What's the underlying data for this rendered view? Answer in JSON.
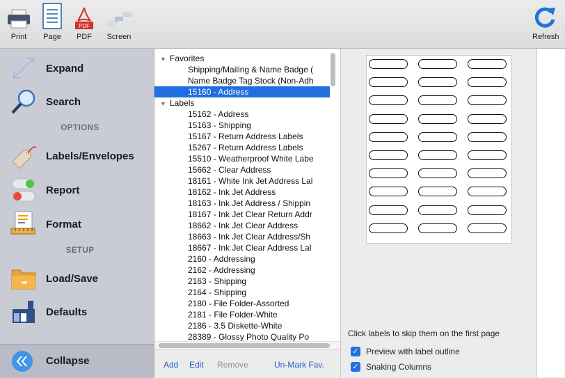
{
  "toolbar": {
    "items": [
      {
        "label": "Print",
        "icon": "printer-icon"
      },
      {
        "label": "Page",
        "icon": "page-icon"
      },
      {
        "label": "PDF",
        "icon": "pdf-icon",
        "badge": "PDF"
      },
      {
        "label": "Screen",
        "icon": "screen-icon"
      }
    ],
    "refresh_label": "Refresh"
  },
  "sidebar": {
    "expand": "Expand",
    "search": "Search",
    "options_header": "OPTIONS",
    "labels_envelopes": "Labels/Envelopes",
    "report": "Report",
    "format": "Format",
    "setup_header": "SETUP",
    "load_save": "Load/Save",
    "defaults": "Defaults",
    "collapse": "Collapse"
  },
  "list": {
    "favorites_header": "Favorites",
    "favorites": [
      "Shipping/Mailing & Name Badge (",
      "Name Badge Tag Stock (Non-Adh",
      "15160 - Address"
    ],
    "selected": "15160 - Address",
    "labels_header": "Labels",
    "labels": [
      "15162 - Address",
      "15163 - Shipping",
      "15167 - Return Address Labels",
      "15267 - Return Address Labels",
      "15510 - Weatherproof White Labe",
      "15662 - Clear Address",
      "18161 - White Ink Jet Address Lal",
      "18162 - Ink Jet Address",
      "18163 - Ink Jet Address / Shippin",
      "18167 - Ink Jet Clear Return Addr",
      "18662 - Ink Jet Clear Address",
      "18663 - Ink Jet Clear Address/Sh",
      "18667 - Ink Jet Clear Address Lal",
      "2160 - Addressing",
      "2162 - Addressing",
      "2163 - Shipping",
      "2164 - Shipping",
      "2180 - File Folder-Assorted",
      "2181 - File Folder-White",
      "2186 - 3.5 Diskette-White",
      "28389 - Glossy Photo Quality Po"
    ],
    "actions": {
      "add": "Add",
      "edit": "Edit",
      "remove": "Remove",
      "unmark": "Un-Mark Fav."
    }
  },
  "preview": {
    "skip_text": "Click labels to skip them on the first page",
    "outline_label": "Preview with label outline",
    "outline_checked": true,
    "snaking_label": "Snaking Columns",
    "snaking_checked": true,
    "label_grid": {
      "columns": 3,
      "rows": 10
    }
  },
  "colors": {
    "selection": "#1f6fe0",
    "sidebar": "#c9cbd5",
    "link": "#1d5fd1"
  }
}
